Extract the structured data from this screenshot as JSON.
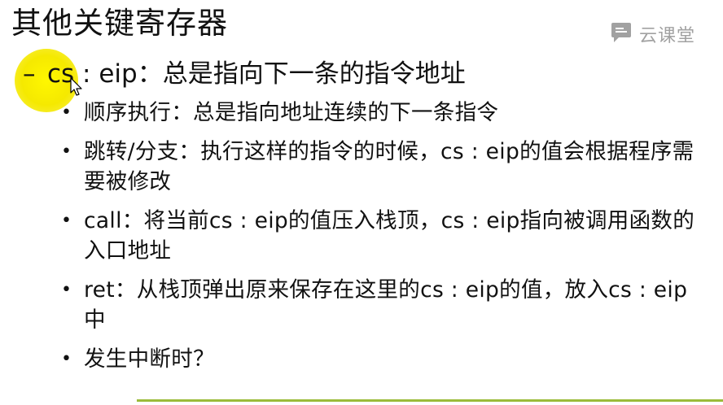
{
  "slide": {
    "title": "其他关键寄存器",
    "watermark": {
      "text": "云课堂",
      "icon": "chat-bubble-icon"
    },
    "main_point": {
      "dash": "–",
      "text": "cs : eip：总是指向下一条的指令地址"
    },
    "bullets": [
      {
        "symbol": "•",
        "text": "顺序执行：总是指向地址连续的下一条指令"
      },
      {
        "symbol": "•",
        "text": "跳转/分支：执行这样的指令的时候，cs : eip的值会根据程序需要被修改"
      },
      {
        "symbol": "•",
        "text": "call：将当前cs : eip的值压入栈顶，cs : eip指向被调用函数的入口地址"
      },
      {
        "symbol": "•",
        "text": "ret：从栈顶弹出原来保存在这里的cs : eip的值，放入cs : eip中"
      },
      {
        "symbol": "•",
        "text": "发生中断时？"
      }
    ]
  },
  "colors": {
    "highlight": "#fff700",
    "bottom_bar": "#9bbb3a",
    "text": "#111111",
    "watermark": "#555555"
  }
}
